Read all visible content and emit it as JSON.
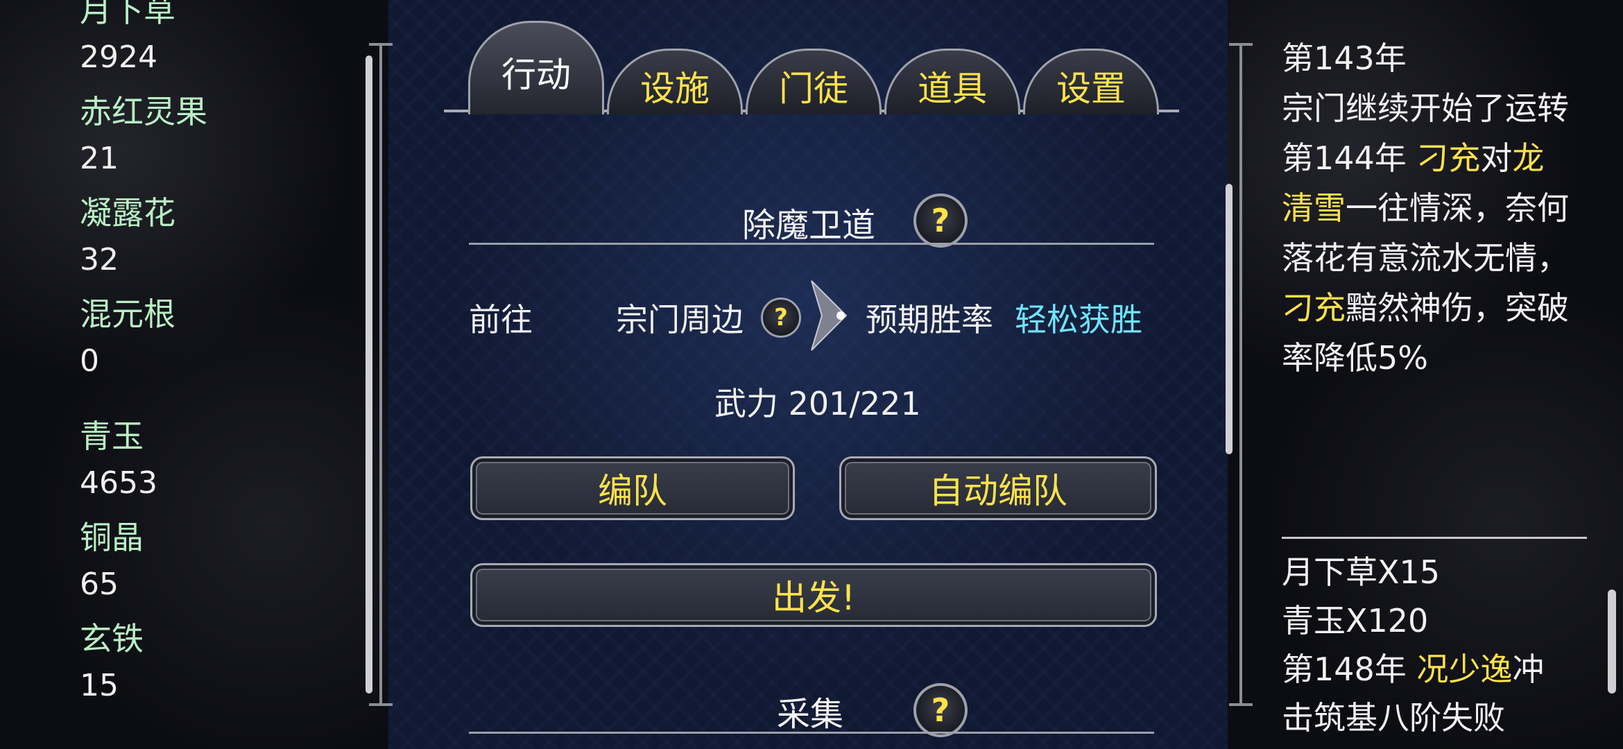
{
  "resources_top": [
    {
      "name": "月下草",
      "value": "2924"
    },
    {
      "name": "赤红灵果",
      "value": "21"
    },
    {
      "name": "凝露花",
      "value": "32"
    },
    {
      "name": "混元根",
      "value": "0"
    }
  ],
  "resources_bottom": [
    {
      "name": "青玉",
      "value": "4653"
    },
    {
      "name": "铜晶",
      "value": "65"
    },
    {
      "name": "玄铁",
      "value": "15"
    }
  ],
  "tabs": [
    {
      "label": "行动",
      "active": true
    },
    {
      "label": "设施",
      "active": false
    },
    {
      "label": "门徒",
      "active": false
    },
    {
      "label": "道具",
      "active": false
    },
    {
      "label": "设置",
      "active": false
    }
  ],
  "mission": {
    "title": "除魔卫道",
    "help_icon": "question-mark",
    "goto_label": "前往",
    "location": "宗门周边",
    "win_label": "预期胜率",
    "win_value": "轻松获胜",
    "power_label": "武力 201/221",
    "team_button": "编队",
    "auto_team_button": "自动编队",
    "depart_button": "出发!"
  },
  "gather": {
    "title": "采集"
  },
  "log_top": [
    [
      {
        "t": "第143年",
        "c": "w"
      }
    ],
    [
      {
        "t": "宗门继续开始了运转",
        "c": "w"
      }
    ],
    [
      {
        "t": "第144年 ",
        "c": "w"
      },
      {
        "t": "刁充",
        "c": "y"
      },
      {
        "t": "对",
        "c": "w"
      },
      {
        "t": "龙清雪",
        "c": "y"
      },
      {
        "t": "一往情深，奈何落花有意流水无情，",
        "c": "w"
      },
      {
        "t": "刁充",
        "c": "y"
      },
      {
        "t": "黯然神伤，突破率降低5%",
        "c": "w"
      }
    ]
  ],
  "log_bottom": [
    [
      {
        "t": "月下草X15",
        "c": "w"
      }
    ],
    [
      {
        "t": "青玉X120",
        "c": "w"
      }
    ],
    [
      {
        "t": "第148年 ",
        "c": "w"
      },
      {
        "t": "况少逸",
        "c": "y"
      },
      {
        "t": "冲击筑基八阶失败",
        "c": "w"
      }
    ]
  ],
  "colors": {
    "resource_name": "#b8efc4",
    "accent_yellow": "#ffe24a",
    "accent_cyan": "#6fe4ff"
  }
}
